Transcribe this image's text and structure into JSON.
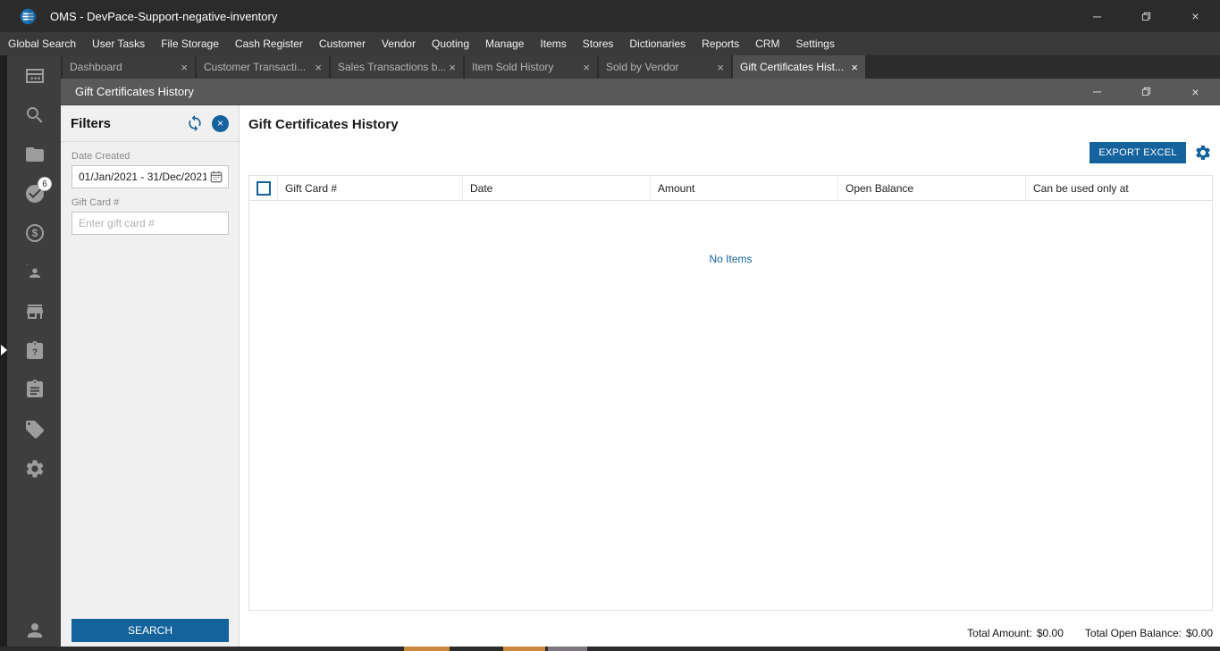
{
  "glyphs": {
    "close": "×"
  },
  "titlebar": {
    "title": "OMS - DevPace-Support-negative-inventory"
  },
  "menu": {
    "items": [
      "Global Search",
      "User Tasks",
      "File Storage",
      "Cash Register",
      "Customer",
      "Vendor",
      "Quoting",
      "Manage",
      "Items",
      "Stores",
      "Dictionaries",
      "Reports",
      "CRM",
      "Settings"
    ]
  },
  "tabs": [
    {
      "label": "Dashboard"
    },
    {
      "label": "Customer Transacti..."
    },
    {
      "label": "Sales Transactions b..."
    },
    {
      "label": "Item Sold History"
    },
    {
      "label": "Sold by Vendor"
    },
    {
      "label": "Gift Certificates Hist...",
      "active": true
    }
  ],
  "subwindow": {
    "title": "Gift Certificates History"
  },
  "sidebar": {
    "task_badge_count": "6",
    "icons": [
      "dashboard-icon",
      "search-icon",
      "folder-icon",
      "tasks-check-icon",
      "money-icon",
      "customer-card-icon",
      "store-icon",
      "help-clipboard-icon",
      "clipboard-icon",
      "tag-icon",
      "settings-icon",
      "user-icon"
    ]
  },
  "filters": {
    "title": "Filters",
    "date_created_label": "Date Created",
    "date_created_value": "01/Jan/2021 - 31/Dec/2021",
    "gift_card_label": "Gift Card #",
    "gift_card_placeholder": "Enter gift card #",
    "search_button_label": "SEARCH"
  },
  "content": {
    "page_title": "Gift Certificates History",
    "export_button_label": "EXPORT EXCEL",
    "table": {
      "columns": [
        "Gift Card #",
        "Date",
        "Amount",
        "Open Balance",
        "Can be used only at"
      ],
      "rows": [],
      "empty_message": "No Items"
    },
    "totals": {
      "total_amount_label": "Total Amount:",
      "total_amount_value": "$0.00",
      "total_open_balance_label": "Total Open Balance:",
      "total_open_balance_value": "$0.00"
    }
  },
  "colors": {
    "accent_blue": "#15639d",
    "titlebar_bg": "#2b2b2b",
    "sidebar_bg": "#3e3e3e",
    "active_tab_bg": "#4f4f4f",
    "panel_bg": "#f0f0f0",
    "taskbar_orange": "#c8893c"
  }
}
